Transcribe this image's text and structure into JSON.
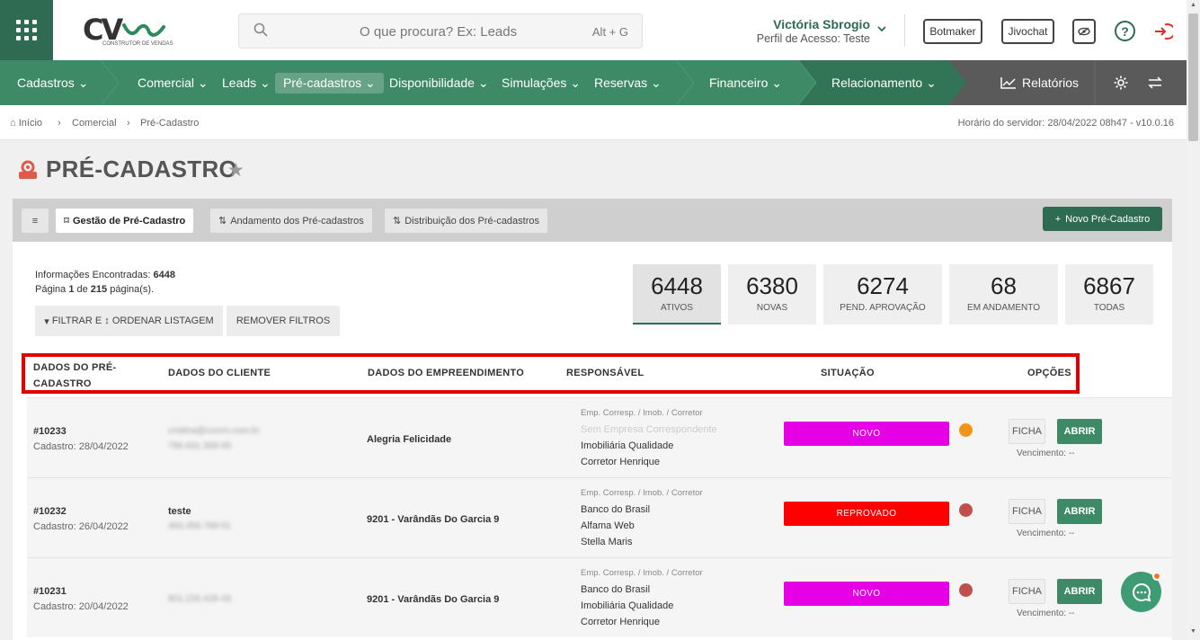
{
  "header": {
    "logo_text": "CV",
    "logo_sub": "CONSTRUTOR DE VENDAS",
    "search_placeholder": "O que procura? Ex: Leads",
    "search_shortcut": "Alt + G",
    "user_name": "Victória Sbrogio",
    "user_role": "Perfil de Acesso: Teste",
    "buttons": [
      "Botmaker",
      "Jivochat"
    ]
  },
  "nav": {
    "items": [
      "Cadastros",
      "Comercial",
      "Leads",
      "Pré-cadastros",
      "Disponibilidade",
      "Simulações",
      "Reservas",
      "Financeiro",
      "Relacionamento",
      "Relatórios"
    ],
    "active": "Pré-cadastros",
    "colors": {
      "main": "#3e8a66",
      "dark": "#2e6b52",
      "gray": "#5a5a5a"
    }
  },
  "breadcrumb": [
    "Início",
    "Comercial",
    "Pré-Cadastro"
  ],
  "server_time": "Horário do servidor: 28/04/2022 08h47 - v10.0.16",
  "page_title": "PRÉ-CADASTRO",
  "tabs": [
    "Gestão de Pré-Cadastro",
    "Andamento dos Pré-cadastros",
    "Distribuição dos Pré-cadastros"
  ],
  "new_button": "Novo Pré-Cadastro",
  "info": {
    "found_label": "Informações Encontradas: ",
    "found_value": "6448",
    "page_prefix": "Página ",
    "page_current": "1",
    "page_of": " de ",
    "page_total": "215",
    "page_suffix": " página(s)."
  },
  "filter_buttons": [
    "FILTRAR E ↕ ORDENAR LISTAGEM",
    "REMOVER FILTROS"
  ],
  "kpis": [
    {
      "value": "6448",
      "label": "ATIVOS"
    },
    {
      "value": "6380",
      "label": "NOVAS"
    },
    {
      "value": "6274",
      "label": "PEND. APROVAÇÃO"
    },
    {
      "value": "68",
      "label": "EM ANDAMENTO"
    },
    {
      "value": "6867",
      "label": "TODAS"
    }
  ],
  "columns": [
    "DADOS DO PRÉ-CADASTRO",
    "DADOS DO CLIENTE",
    "DADOS DO EMPREENDIMENTO",
    "RESPONSÁVEL",
    "SITUAÇÃO",
    "OPÇÕES"
  ],
  "rows": [
    {
      "id": "#10233",
      "date": "Cadastro: 28/04/2022",
      "client_name": "",
      "client_line1": "cristina@cvcrm.com.br",
      "client_line2": "796.631.359-00",
      "enterprise": "Alegria Felicidade",
      "resp_header": "Emp. Corresp. / Imob. / Corretor",
      "resp_lines": [
        "Sem Empresa Correspondente",
        "Imobiliária Qualidade",
        "Corretor Henrique"
      ],
      "status": "NOVO",
      "status_color": "#e600e6",
      "dot_color": "#f0951a",
      "ficha": "FICHA",
      "abrir": "ABRIR",
      "vencimento": "Vencimento: --"
    },
    {
      "id": "#10232",
      "date": "Cadastro: 26/04/2022",
      "client_name": "teste",
      "client_line1": "483.456.789-01",
      "client_line2": "",
      "enterprise": "9201 - Varândãs Do Garcia 9",
      "resp_header": "Emp. Corresp. / Imob. / Corretor",
      "resp_lines": [
        "Banco do Brasil",
        "Alfama Web",
        "Stella Maris"
      ],
      "status": "REPROVADO",
      "status_color": "#ff0000",
      "dot_color": "#c0504d",
      "ficha": "FICHA",
      "abrir": "ABRIR",
      "vencimento": "Vencimento: --"
    },
    {
      "id": "#10231",
      "date": "Cadastro: 20/04/2022",
      "client_name": "",
      "client_line1": "801.226.428-43",
      "client_line2": "",
      "enterprise": "9201 - Varândãs Do Garcia 9",
      "resp_header": "Emp. Corresp. / Imob. / Corretor",
      "resp_lines": [
        "Banco do Brasil",
        "Imobiliária Qualidade",
        "Corretor Henrique"
      ],
      "status": "NOVO",
      "status_color": "#e600e6",
      "dot_color": "#c0504d",
      "ficha": "FICHA",
      "abrir": "ABRIR",
      "vencimento": "Vencimento: --"
    }
  ]
}
